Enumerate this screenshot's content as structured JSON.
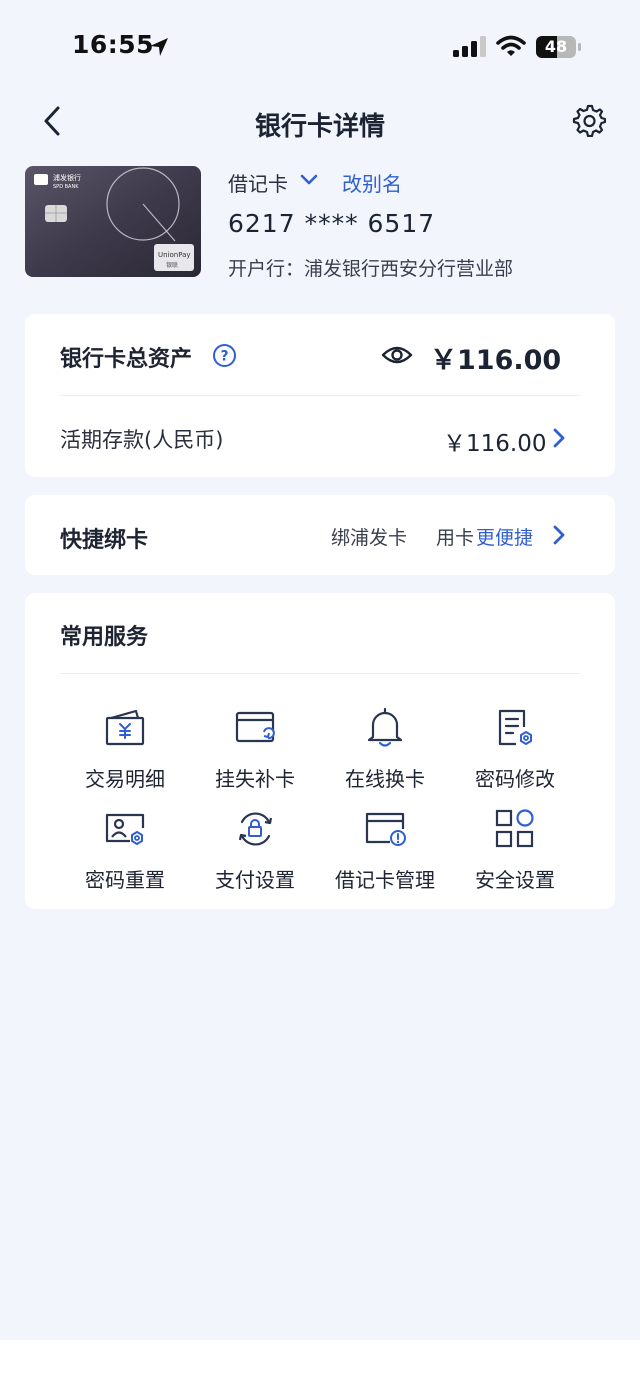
{
  "status_bar": {
    "time": "16:55",
    "battery": "48"
  },
  "nav": {
    "title": "银行卡详情",
    "back_icon": "back-icon",
    "settings_icon": "gear-icon"
  },
  "card": {
    "type": "借记卡",
    "rename": "改别名",
    "number": "6217 **** 6517",
    "bank": "开户行：浦发银行西安分行营业部",
    "card_logo_cn": "浦发银行",
    "card_logo_en": "SPD BANK",
    "card_network": "UnionPay",
    "card_network_cn": "银联"
  },
  "assets": {
    "label": "银行卡总资产",
    "total": "￥116.00",
    "deposit_label": "活期存款(人民币)",
    "deposit_value": "￥116.00"
  },
  "quick_bind": {
    "label": "快捷绑卡",
    "hint_prefix": "绑浦发卡",
    "hint_mid": "用卡",
    "hint_highlight": "更便捷"
  },
  "services": {
    "title": "常用服务",
    "items": [
      {
        "label": "交易明细",
        "icon": "transaction-details-icon"
      },
      {
        "label": "挂失补卡",
        "icon": "report-loss-icon"
      },
      {
        "label": "在线换卡",
        "icon": "bell-icon"
      },
      {
        "label": "密码修改",
        "icon": "change-password-icon"
      },
      {
        "label": "密码重置",
        "icon": "reset-password-icon"
      },
      {
        "label": "支付设置",
        "icon": "payment-settings-icon"
      },
      {
        "label": "借记卡管理",
        "icon": "debit-card-management-icon"
      },
      {
        "label": "安全设置",
        "icon": "security-settings-icon"
      }
    ]
  },
  "colors": {
    "accent": "#2f5fd0",
    "background": "#f2f6fc",
    "icon_stroke": "#2a3550"
  }
}
